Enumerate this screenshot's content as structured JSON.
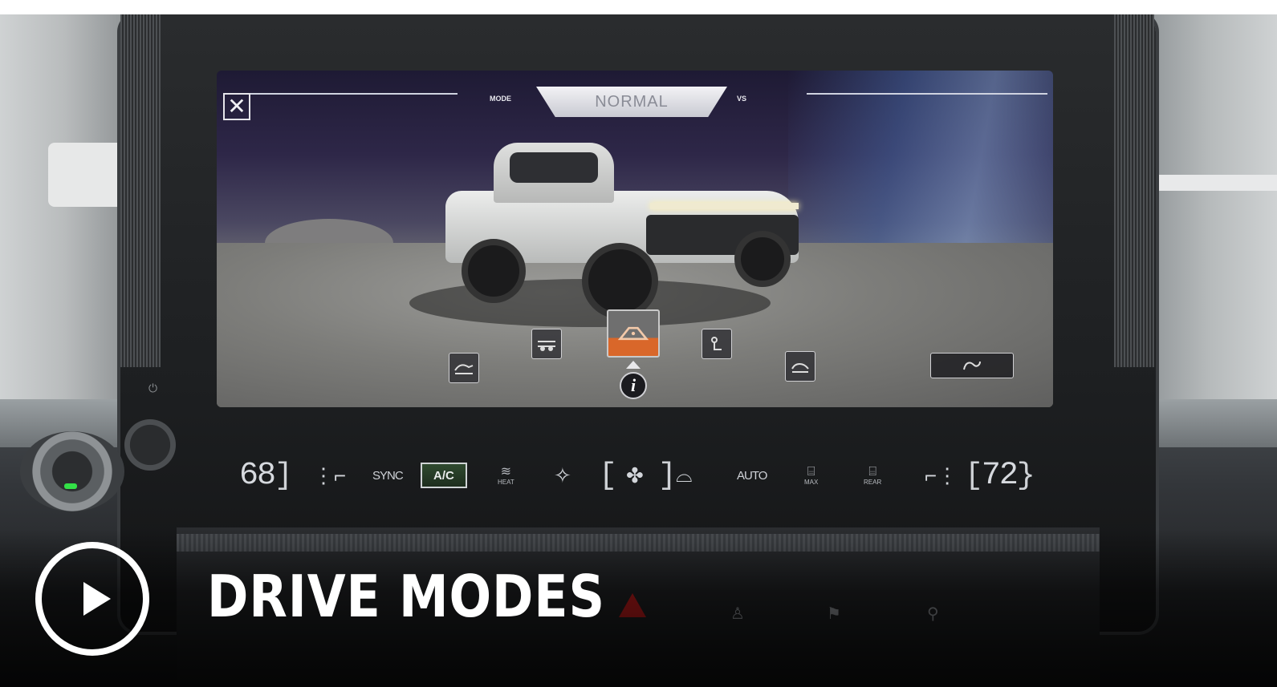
{
  "screen": {
    "mode_label": "MODE",
    "mode_value": "NORMAL",
    "vs_label": "VS",
    "close_glyph": "✕",
    "info_glyph": "i",
    "drive_modes": [
      {
        "name": "terrain-mode-icon"
      },
      {
        "name": "off-road-mode-icon"
      },
      {
        "name": "normal-mode-icon",
        "selected": true
      },
      {
        "name": "my-mode-icon"
      },
      {
        "name": "tow-mode-icon"
      },
      {
        "name": "watts-to-freedom-icon"
      }
    ]
  },
  "climate": {
    "left_temp": "68",
    "right_temp": "72",
    "sync_label": "SYNC",
    "ac_label": "A/C",
    "heat_label": "HEAT",
    "auto_label": "AUTO",
    "max_label": "MAX",
    "rear_label": "REAR"
  },
  "overlay": {
    "title": "DRIVE MODES"
  },
  "colors": {
    "accent_orange": "#d9672a",
    "title_white": "#ffffff",
    "hazard_red": "#cc1d1d",
    "indicator_green": "#33e047"
  }
}
